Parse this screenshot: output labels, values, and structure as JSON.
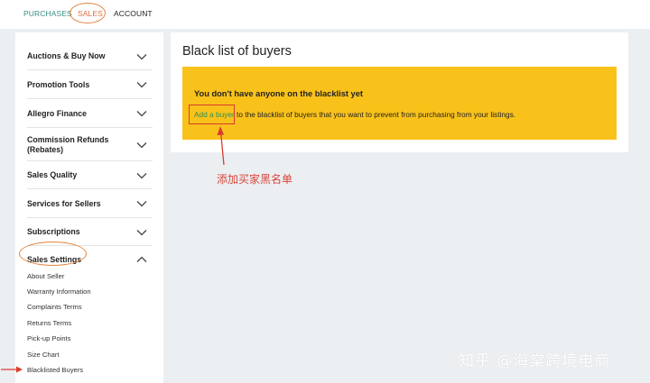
{
  "nav": {
    "tabs": [
      {
        "label": "PURCHASES"
      },
      {
        "label": "SALES"
      },
      {
        "label": "ACCOUNT"
      }
    ],
    "active_tab": "SALES"
  },
  "sidebar": {
    "items": [
      {
        "label": "Auctions & Buy Now",
        "expanded": false
      },
      {
        "label": "Promotion Tools",
        "expanded": false
      },
      {
        "label": "Allegro Finance",
        "expanded": false
      },
      {
        "label": "Commission Refunds (Rebates)",
        "expanded": false
      },
      {
        "label": "Sales Quality",
        "expanded": false
      },
      {
        "label": "Services for Sellers",
        "expanded": false
      },
      {
        "label": "Subscriptions",
        "expanded": false
      },
      {
        "label": "Sales Settings",
        "expanded": true
      }
    ],
    "sub_items": [
      {
        "label": "About Seller"
      },
      {
        "label": "Warranty Information"
      },
      {
        "label": "Complaints Terms"
      },
      {
        "label": "Returns Terms"
      },
      {
        "label": "Pick-up Points"
      },
      {
        "label": "Size Chart"
      },
      {
        "label": "Blacklisted Buyers"
      }
    ]
  },
  "main": {
    "title": "Black list of buyers",
    "notice": {
      "heading": "You don't have anyone on the blacklist yet",
      "link_text": "Add a buyer",
      "rest_text": " to the blacklist of buyers that you want to prevent from purchasing from your listings."
    }
  },
  "annotations": {
    "note": "添加买家黑名单",
    "watermark": "知乎 @海棠跨境电商"
  },
  "colors": {
    "accent_orange": "#e6843e",
    "teal": "#3a8f84",
    "notice_yellow": "#f9c21b",
    "link_green": "#2e8f55",
    "annotation_red": "#d93b2f",
    "page_bg": "#eceff1"
  }
}
